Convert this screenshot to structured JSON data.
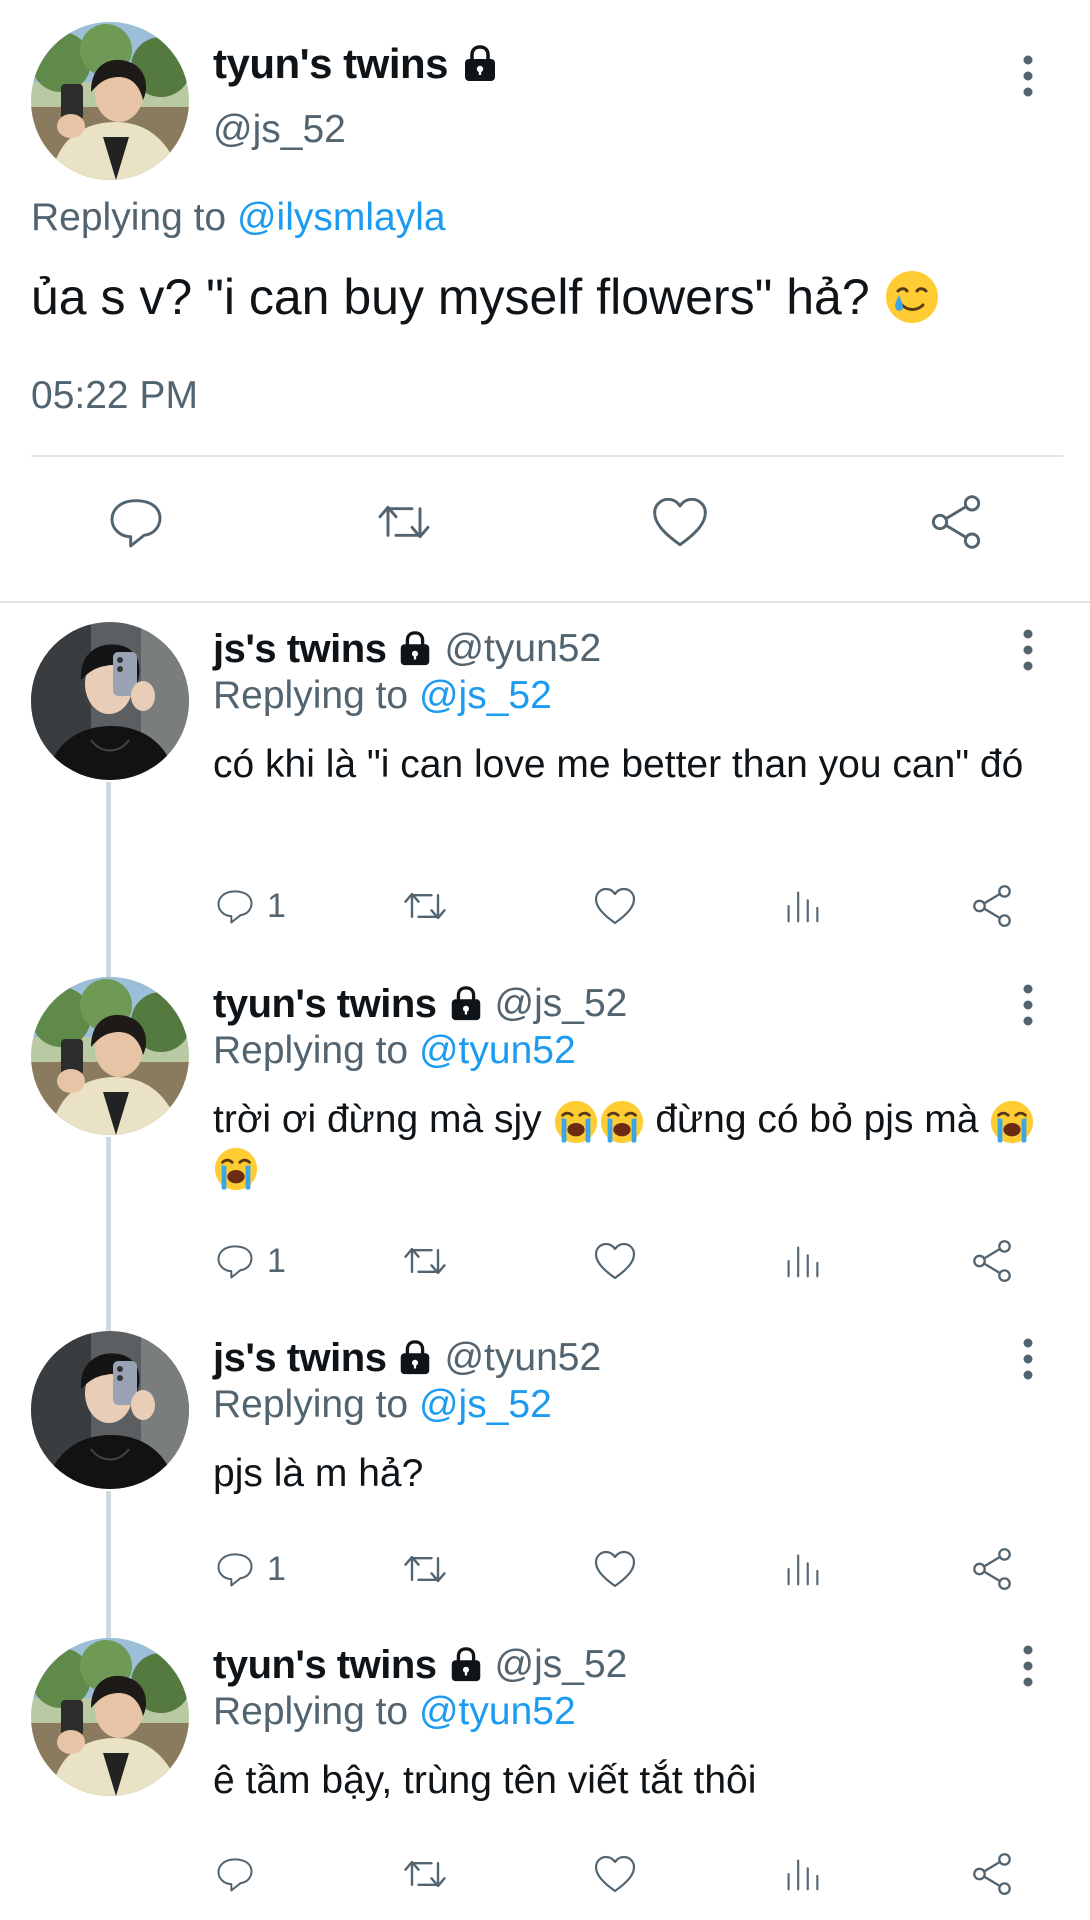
{
  "main_tweet": {
    "display_name": "tyun's twins",
    "handle": "@js_52",
    "replying_prefix": "Replying to",
    "replying_to": "@ilysmlayla",
    "text": "ủa s v? \"i can buy myself flowers\" hả?",
    "text_emoji": "smiling-face-with-tear",
    "time": "05:22 PM",
    "actions": [
      "reply-icon",
      "retweet-icon",
      "like-icon",
      "share-icon"
    ]
  },
  "replies": [
    {
      "display_name": "js's twins",
      "handle": "@tyun52",
      "replying_prefix": "Replying to",
      "replying_to": "@js_52",
      "text": "có khi là \"i can love me better than you can\" đó",
      "reply_count": "1",
      "avatar": "dark-haired-person-black-shirt"
    },
    {
      "display_name": "tyun's twins",
      "handle": "@js_52",
      "replying_prefix": "Replying to",
      "replying_to": "@tyun52",
      "text_part1": "trời ơi đừng mà sjy",
      "text_part2": "đừng có bỏ pjs mà",
      "emoji": "loudly-crying-face",
      "reply_count": "1",
      "avatar": "person-beige-jacket-trees"
    },
    {
      "display_name": "js's twins",
      "handle": "@tyun52",
      "replying_prefix": "Replying to",
      "replying_to": "@js_52",
      "text": "pjs là m hả?",
      "reply_count": "1",
      "avatar": "dark-haired-person-black-shirt"
    },
    {
      "display_name": "tyun's twins",
      "handle": "@js_52",
      "replying_prefix": "Replying to",
      "replying_to": "@tyun52",
      "text": "ê tầm bậy, trùng tên viết tắt thôi",
      "reply_count": "",
      "avatar": "person-beige-jacket-trees"
    }
  ],
  "colors": {
    "text": "#0f1419",
    "secondary": "#536471",
    "link": "#1d9bf0",
    "divider": "#e1e5e9",
    "thread_line": "#cfd9de"
  }
}
